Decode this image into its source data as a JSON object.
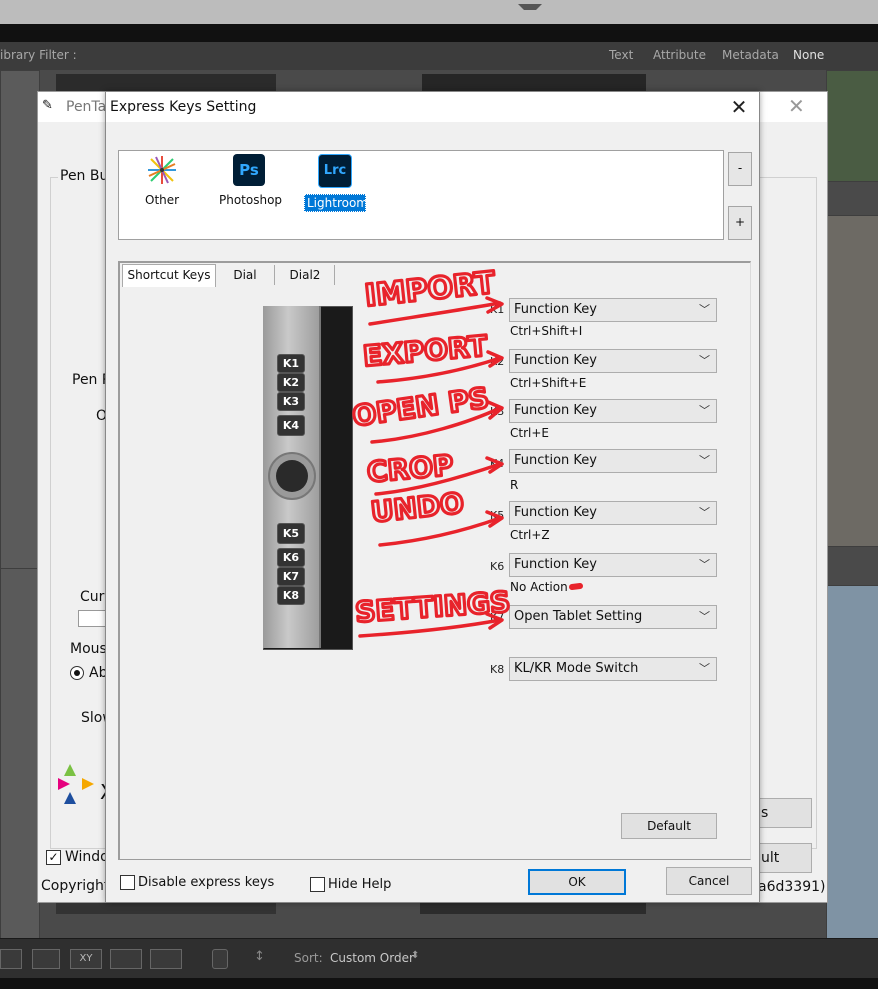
{
  "lightroom": {
    "filter_label": "ibrary Filter :",
    "filter_tabs": [
      "Text",
      "Attribute",
      "Metadata",
      "None"
    ],
    "sort_label": "Sort:",
    "sort_value": "Custom Order"
  },
  "pentablet": {
    "title": "PenTal",
    "pen_buttons_label": "Pen Bu",
    "pen_pressure_label": "Pen P",
    "o_label": "O",
    "curr_label": "Curr",
    "mouse_label": "Mous",
    "abs_label": "Ab",
    "slow_label": "Slow",
    "windows_ink_label": "Windo",
    "copyright": "Copyright",
    "version_tail": "a6d3391)",
    "express_settings_btn": "s Settin",
    "default_btn_partial": "ult",
    "logo_letter": "X"
  },
  "dialog": {
    "title": "Express Keys Setting",
    "apps": [
      {
        "label": "Other",
        "icon": "starburst-icon"
      },
      {
        "label": "Photoshop",
        "icon_text": "Ps",
        "color": "#31a8ff"
      },
      {
        "label": "Lightroom",
        "icon_text": "Lrc",
        "color": "#31a8ff",
        "selected": true
      }
    ],
    "remove_btn": "-",
    "add_btn": "+",
    "tabs": [
      "Shortcut Keys",
      "Dial",
      "Dial2"
    ],
    "device_keys": [
      "K1",
      "K2",
      "K3",
      "K4",
      "K5",
      "K6",
      "K7",
      "K8"
    ],
    "keys": [
      {
        "label": "K1",
        "action": "Function Key",
        "shortcut": "Ctrl+Shift+I"
      },
      {
        "label": "K2",
        "action": "Function Key",
        "shortcut": "Ctrl+Shift+E"
      },
      {
        "label": "K3",
        "action": "Function Key",
        "shortcut": "Ctrl+E"
      },
      {
        "label": "K4",
        "action": "Function Key",
        "shortcut": "R"
      },
      {
        "label": "K5",
        "action": "Function Key",
        "shortcut": "Ctrl+Z"
      },
      {
        "label": "K6",
        "action": "Function Key",
        "shortcut": "No Action"
      },
      {
        "label": "K7",
        "action": "Open Tablet Setting",
        "shortcut": ""
      },
      {
        "label": "K8",
        "action": "KL/KR Mode Switch",
        "shortcut": ""
      }
    ],
    "default_btn": "Default",
    "disable_label": "Disable express keys",
    "hide_help_label": "Hide Help",
    "ok_btn": "OK",
    "cancel_btn": "Cancel"
  },
  "annotations": [
    "IMPORT",
    "EXPORT",
    "OPEN PS",
    "CROP",
    "UNDO",
    "SETTINGS"
  ],
  "colors": {
    "annotation": "#e8232b",
    "selection": "#0078d7",
    "adobe_blue": "#31a8ff"
  }
}
